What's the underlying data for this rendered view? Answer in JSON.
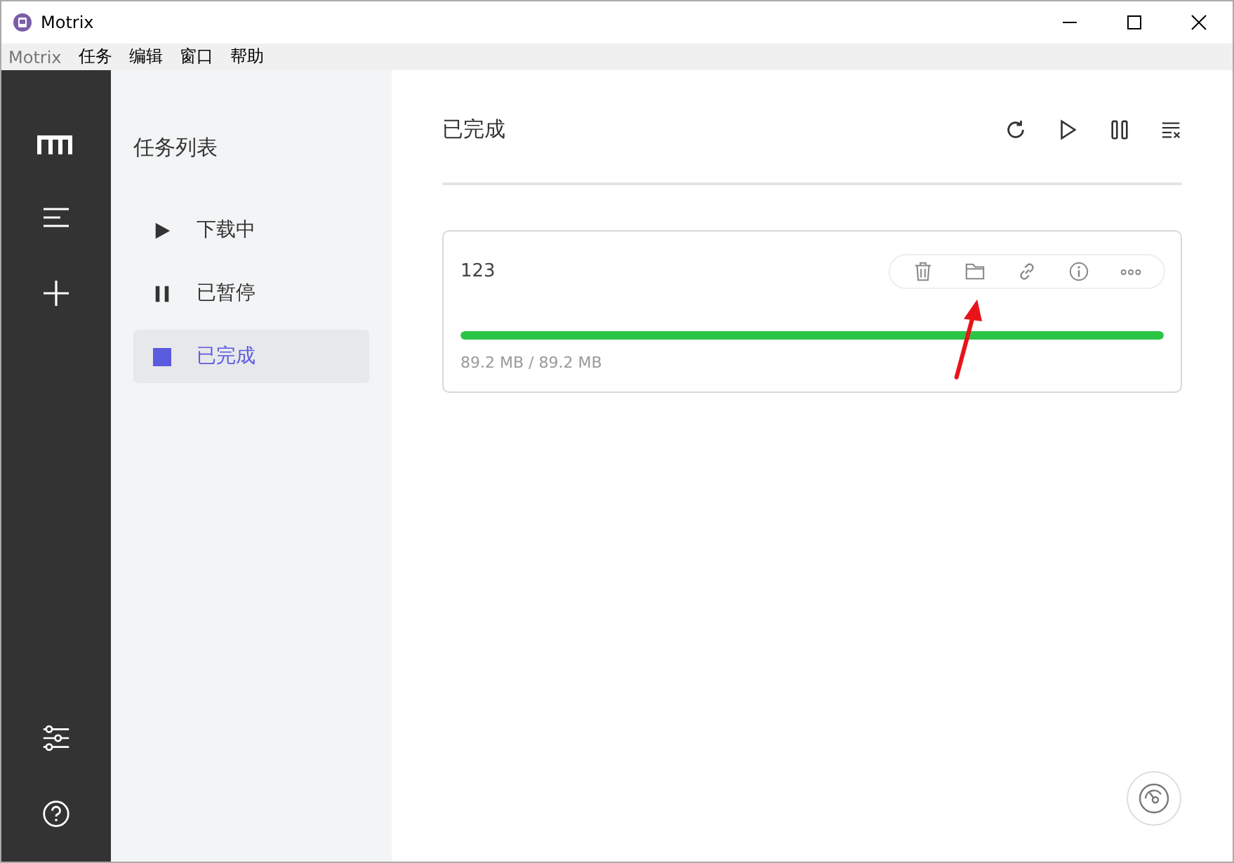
{
  "window": {
    "title": "Motrix"
  },
  "menu": [
    "Motrix",
    "任务",
    "编辑",
    "窗口",
    "帮助"
  ],
  "task_list": {
    "title": "任务列表",
    "items": [
      {
        "label": "下载中",
        "kind": "play",
        "selected": false
      },
      {
        "label": "已暂停",
        "kind": "pause",
        "selected": false
      },
      {
        "label": "已完成",
        "kind": "stop",
        "selected": true
      }
    ]
  },
  "main": {
    "title": "已完成"
  },
  "tasks": [
    {
      "name": "123",
      "level": 1,
      "progress_text": "89.2 MB / 89.2 MB"
    }
  ]
}
